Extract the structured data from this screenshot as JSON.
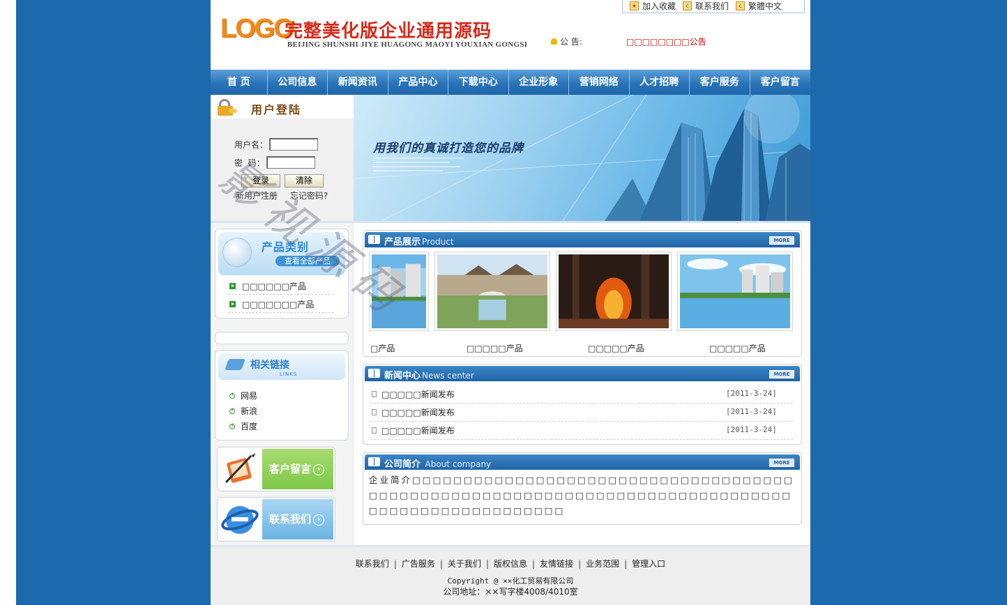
{
  "header": {
    "logo_en": "LOGO",
    "logo_cn": "完整美化版企业通用源码",
    "logo_sub": "BEIJING SHUNSHI JIYE HUAGONG MAOYI YOUXIAN GONGSI",
    "top_links": [
      {
        "label": "加入收藏",
        "icon": "bookmark-icon"
      },
      {
        "label": "联系我们",
        "icon": "contact-icon"
      },
      {
        "label": "繁體中文",
        "icon": "language-icon"
      }
    ],
    "notice_label": "公 告:",
    "notice_text": "□□□□□□□□公告"
  },
  "nav": [
    "首 页",
    "公司信息",
    "新闻资讯",
    "产品中心",
    "下载中心",
    "企业形象",
    "营销网络",
    "人才招聘",
    "客户服务",
    "客户留言"
  ],
  "login": {
    "title": "用户登陆",
    "username_label": "用户名：",
    "username_value": "",
    "password_label": "密  码：",
    "password_value": "",
    "login_button": "登录",
    "clear_button": "清除",
    "register_link": "新用户注册",
    "forgot_link": "忘记密码?"
  },
  "banner": {
    "slogan": "用我们的真诚打造您的品牌"
  },
  "categories": {
    "title": "产品类别",
    "view_all": "查看全部产品",
    "items": [
      "□□□□□□产品",
      "□□□□□□□产品"
    ]
  },
  "links": {
    "title": "相关链接",
    "subtitle": "LINKS",
    "items": [
      "网易",
      "新浪",
      "百度"
    ]
  },
  "promos": [
    {
      "label": "客户留言",
      "icon": "guestbook-icon"
    },
    {
      "label": "联系我们",
      "icon": "ie-globe-icon"
    }
  ],
  "products": {
    "title": "产品展示",
    "title_en": "Product",
    "more": "MORE",
    "items": [
      "□产品",
      "□□□□□产品",
      "□□□□□产品",
      "□□□□□产品"
    ]
  },
  "news": {
    "title": "新闻中心",
    "title_en": "News center",
    "more": "MORE",
    "items": [
      {
        "title": "□□□□□新闻发布",
        "date": "[2011-3-24]"
      },
      {
        "title": "□□□□□新闻发布",
        "date": "[2011-3-24]"
      },
      {
        "title": "□□□□□新闻发布",
        "date": "[2011-3-24]"
      }
    ]
  },
  "about": {
    "title": "公司简介",
    "title_en": "About company",
    "more": "MORE",
    "text": "企业简介□□□□□□□□□□□□□□□□□□□□□□□□□□□□□□□□□□□□□□□□□□□□□□□□□□□□□□□□□□□□□□□□□□□□□□□□□□□□□□□□□□□□□□□□□□□□□□□□□"
  },
  "footer": {
    "links": [
      "联系我们",
      "广告服务",
      "关于我们",
      "版权信息",
      "友情链接",
      "业务范围",
      "管理入口"
    ],
    "copyright": "Copyright @ ××化工贸易有限公司",
    "address": "公司地址：××写字楼4008/4010室"
  },
  "watermark": "影视源码",
  "colors": {
    "background": "#1d69ad",
    "nav": "#2a73b8",
    "accent_red": "#c40000",
    "logo_orange": "#f08a1c",
    "logo_red": "#d62a1a"
  }
}
